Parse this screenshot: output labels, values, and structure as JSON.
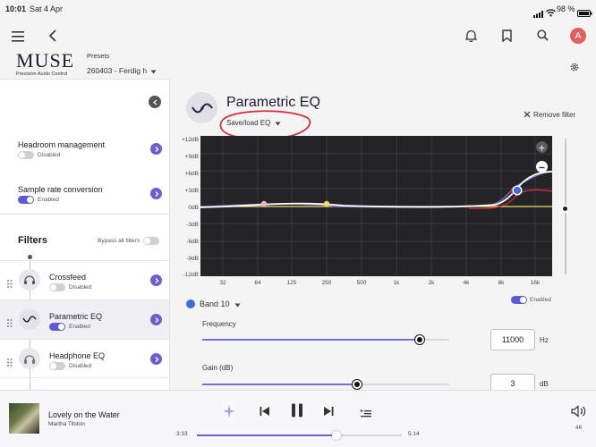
{
  "status_bar": {
    "time": "10:01",
    "date": "Sat 4 Apr",
    "battery": "98 %"
  },
  "topbar": {
    "avatar_initial": "A"
  },
  "brand": {
    "name": "MUSE",
    "tagline": "Precision Audio Control"
  },
  "presets": {
    "label": "Presets",
    "value": "260403 - Ferdig h"
  },
  "sidebar": {
    "headroom": {
      "label": "Headroom management",
      "status": "Disabled"
    },
    "sample_rate": {
      "label": "Sample rate conversion",
      "status": "Enabled"
    },
    "filters_title": "Filters",
    "bypass_label": "Bypass all filters",
    "filters": [
      {
        "name": "Crossfeed",
        "status": "Disabled"
      },
      {
        "name": "Parametric EQ",
        "status": "Enabled"
      },
      {
        "name": "Headphone EQ",
        "status": "Disabled"
      }
    ]
  },
  "eq": {
    "title": "Parametric EQ",
    "save_load": "Save/load EQ",
    "remove_filter": "Remove filter",
    "y_labels": [
      "+12dB",
      "+9dB",
      "+6dB",
      "+3dB",
      "0dB",
      "-3dB",
      "-6dB",
      "-9dB",
      "-12dB"
    ],
    "x_labels": [
      "32",
      "64",
      "125",
      "250",
      "500",
      "1k",
      "2k",
      "4k",
      "8k",
      "16k"
    ],
    "band": "Band 10",
    "band_status": "Enabled",
    "frequency_label": "Frequency",
    "frequency_value": "11000",
    "frequency_unit": "Hz",
    "frequency_fraction": 0.88,
    "gain_label": "Gain (dB)",
    "gain_value": "3",
    "gain_unit": "dB",
    "gain_fraction": 0.625
  },
  "player": {
    "title": "Lovely on the Water",
    "artist": "Martha Tilston",
    "elapsed": "3:33",
    "total": "5:14",
    "progress_fraction": 0.68,
    "volume": "46"
  },
  "colors": {
    "accent": "#5b5bd6",
    "graph_bg": "#242427",
    "annotation": "#d6303f"
  }
}
